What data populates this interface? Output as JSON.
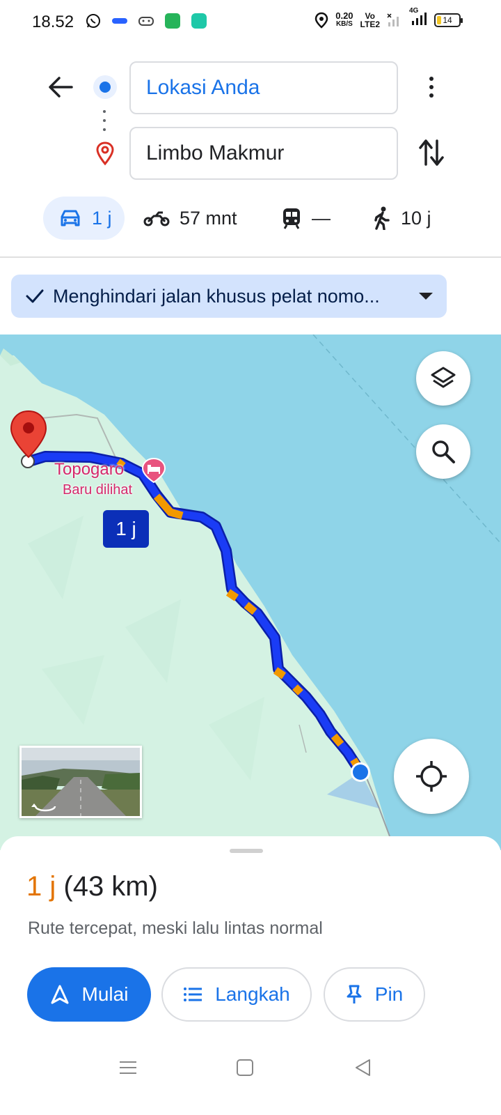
{
  "status_bar": {
    "time": "18.52",
    "net_speed_value": "0.20",
    "net_speed_unit": "KB/S",
    "volte_top": "Vo",
    "volte_bottom": "LTE2",
    "network_type": "4G",
    "battery_level": "14"
  },
  "route": {
    "origin": "Lokasi Anda",
    "destination": "Limbo Makmur"
  },
  "modes": [
    {
      "id": "car",
      "label": "1 j",
      "icon": "car-icon",
      "active": true
    },
    {
      "id": "motorcycle",
      "label": "57 mnt",
      "icon": "motorcycle-icon",
      "active": false
    },
    {
      "id": "transit",
      "label": "—",
      "icon": "train-icon",
      "active": false
    },
    {
      "id": "walk",
      "label": "10 j",
      "icon": "walk-icon",
      "active": false
    }
  ],
  "filter": {
    "label": "Menghindari jalan khusus pelat nomo..."
  },
  "map": {
    "poi_name": "Topogaro",
    "poi_subtitle": "Baru dilihat",
    "route_badge": "1 j",
    "colors": {
      "water": "#8fd4e8",
      "land": "#d4f2e3",
      "route": "#1a3cf5",
      "traffic": "#f29900",
      "destination": "#ea4335",
      "location": "#1a73e8"
    }
  },
  "summary": {
    "duration": "1 j",
    "distance": "(43 km)",
    "description": "Rute tercepat, meski lalu lintas normal"
  },
  "actions": {
    "start": "Mulai",
    "steps": "Langkah",
    "pin": "Pin"
  },
  "colors": {
    "accent": "#1a73e8",
    "duration": "#e37400"
  }
}
